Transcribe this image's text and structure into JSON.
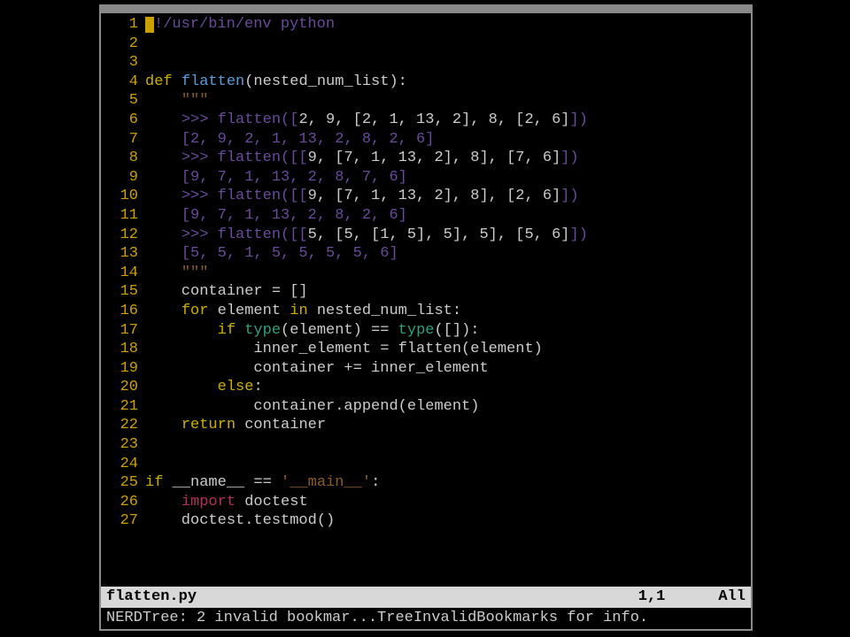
{
  "lines": [
    {
      "n": "1",
      "segments": [
        {
          "cls": "cursor",
          "text": ""
        },
        {
          "cls": "tok-comment",
          "text": "!/usr/bin/env python"
        }
      ]
    },
    {
      "n": "2",
      "segments": []
    },
    {
      "n": "3",
      "segments": []
    },
    {
      "n": "4",
      "segments": [
        {
          "cls": "tok-keyword",
          "text": "def "
        },
        {
          "cls": "tok-def",
          "text": "flatten"
        },
        {
          "cls": "",
          "text": "(nested_num_list):"
        }
      ]
    },
    {
      "n": "5",
      "segments": [
        {
          "cls": "",
          "text": "    "
        },
        {
          "cls": "tok-docmark",
          "text": "\"\"\""
        }
      ]
    },
    {
      "n": "6",
      "segments": [
        {
          "cls": "",
          "text": "    "
        },
        {
          "cls": "tok-comment",
          "text": ">>> flatten(["
        },
        {
          "cls": "tok-comment-brackets",
          "text": "2, 9, [2, 1, 13, 2], 8, [2, 6]"
        },
        {
          "cls": "tok-comment",
          "text": "])"
        }
      ]
    },
    {
      "n": "7",
      "segments": [
        {
          "cls": "",
          "text": "    "
        },
        {
          "cls": "tok-comment",
          "text": "[2, 9, 2, 1, 13, 2, 8, 2, 6]"
        }
      ]
    },
    {
      "n": "8",
      "segments": [
        {
          "cls": "",
          "text": "    "
        },
        {
          "cls": "tok-comment",
          "text": ">>> flatten([["
        },
        {
          "cls": "tok-comment-brackets",
          "text": "9, [7, 1, 13, 2], 8], [7, 6]"
        },
        {
          "cls": "tok-comment",
          "text": "])"
        }
      ]
    },
    {
      "n": "9",
      "segments": [
        {
          "cls": "",
          "text": "    "
        },
        {
          "cls": "tok-comment",
          "text": "[9, 7, 1, 13, 2, 8, 7, 6]"
        }
      ]
    },
    {
      "n": "10",
      "segments": [
        {
          "cls": "",
          "text": "    "
        },
        {
          "cls": "tok-comment",
          "text": ">>> flatten([["
        },
        {
          "cls": "tok-comment-brackets",
          "text": "9, [7, 1, 13, 2], 8], [2, 6]"
        },
        {
          "cls": "tok-comment",
          "text": "])"
        }
      ]
    },
    {
      "n": "11",
      "segments": [
        {
          "cls": "",
          "text": "    "
        },
        {
          "cls": "tok-comment",
          "text": "[9, 7, 1, 13, 2, 8, 2, 6]"
        }
      ]
    },
    {
      "n": "12",
      "segments": [
        {
          "cls": "",
          "text": "    "
        },
        {
          "cls": "tok-comment",
          "text": ">>> flatten([["
        },
        {
          "cls": "tok-comment-brackets",
          "text": "5, [5, [1, 5], 5], 5], [5, 6]"
        },
        {
          "cls": "tok-comment",
          "text": "])"
        }
      ]
    },
    {
      "n": "13",
      "segments": [
        {
          "cls": "",
          "text": "    "
        },
        {
          "cls": "tok-comment",
          "text": "[5, 5, 1, 5, 5, 5, 5, 6]"
        }
      ]
    },
    {
      "n": "14",
      "segments": [
        {
          "cls": "",
          "text": "    "
        },
        {
          "cls": "tok-docmark",
          "text": "\"\"\""
        }
      ]
    },
    {
      "n": "15",
      "segments": [
        {
          "cls": "",
          "text": "    container = []"
        }
      ]
    },
    {
      "n": "16",
      "segments": [
        {
          "cls": "",
          "text": "    "
        },
        {
          "cls": "tok-keyword",
          "text": "for"
        },
        {
          "cls": "",
          "text": " element "
        },
        {
          "cls": "tok-keyword",
          "text": "in"
        },
        {
          "cls": "",
          "text": " nested_num_list:"
        }
      ]
    },
    {
      "n": "17",
      "segments": [
        {
          "cls": "",
          "text": "        "
        },
        {
          "cls": "tok-keyword",
          "text": "if"
        },
        {
          "cls": "",
          "text": " "
        },
        {
          "cls": "tok-builtin",
          "text": "type"
        },
        {
          "cls": "",
          "text": "(element) == "
        },
        {
          "cls": "tok-builtin",
          "text": "type"
        },
        {
          "cls": "",
          "text": "([]):"
        }
      ]
    },
    {
      "n": "18",
      "segments": [
        {
          "cls": "",
          "text": "            inner_element = flatten(element)"
        }
      ]
    },
    {
      "n": "19",
      "segments": [
        {
          "cls": "",
          "text": "            container += inner_element"
        }
      ]
    },
    {
      "n": "20",
      "segments": [
        {
          "cls": "",
          "text": "        "
        },
        {
          "cls": "tok-keyword",
          "text": "else"
        },
        {
          "cls": "",
          "text": ":"
        }
      ]
    },
    {
      "n": "21",
      "segments": [
        {
          "cls": "",
          "text": "            container.append(element)"
        }
      ]
    },
    {
      "n": "22",
      "segments": [
        {
          "cls": "",
          "text": "    "
        },
        {
          "cls": "tok-keyword",
          "text": "return"
        },
        {
          "cls": "",
          "text": " container"
        }
      ]
    },
    {
      "n": "23",
      "segments": []
    },
    {
      "n": "24",
      "segments": []
    },
    {
      "n": "25",
      "segments": [
        {
          "cls": "tok-keyword",
          "text": "if"
        },
        {
          "cls": "",
          "text": " __name__ == "
        },
        {
          "cls": "tok-string",
          "text": "'__main__'"
        },
        {
          "cls": "",
          "text": ":"
        }
      ]
    },
    {
      "n": "26",
      "segments": [
        {
          "cls": "",
          "text": "    "
        },
        {
          "cls": "tok-import",
          "text": "import"
        },
        {
          "cls": "",
          "text": " doctest"
        }
      ]
    },
    {
      "n": "27",
      "segments": [
        {
          "cls": "",
          "text": "    doctest.testmod()"
        }
      ]
    }
  ],
  "status": {
    "filename": "flatten.py",
    "position": "1,1",
    "scroll": "All"
  },
  "message": "NERDTree: 2 invalid bookmar...TreeInvalidBookmarks for info."
}
